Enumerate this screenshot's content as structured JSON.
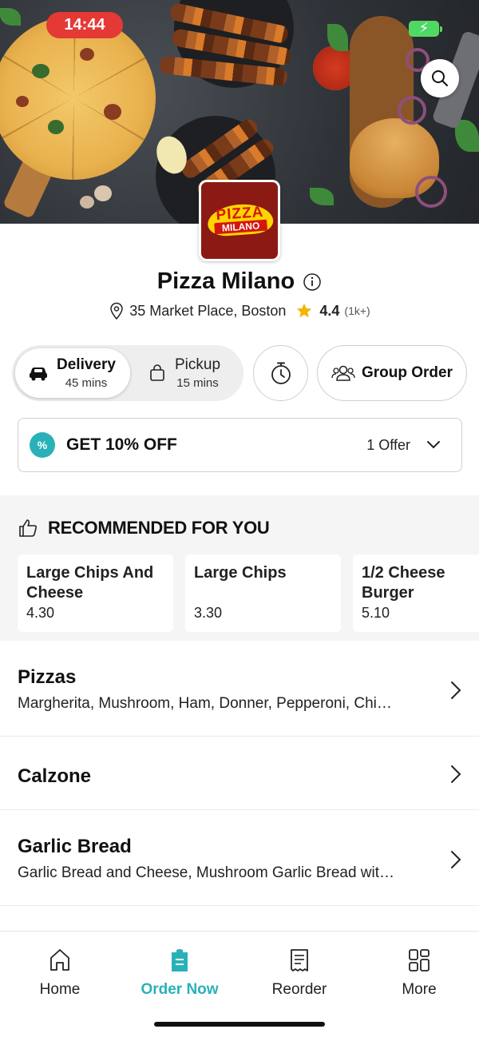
{
  "status": {
    "time": "14:44"
  },
  "restaurant": {
    "name": "Pizza Milano",
    "address": "35 Market Place, Boston",
    "rating": "4.4",
    "rating_count": "(1k+)",
    "logo": {
      "top": "PIZZA",
      "bottom": "MILANO"
    }
  },
  "modes": {
    "delivery": {
      "label": "Delivery",
      "time": "45 mins"
    },
    "pickup": {
      "label": "Pickup",
      "time": "15 mins"
    },
    "group_order_label": "Group Order"
  },
  "offer": {
    "title": "GET 10% OFF",
    "count": "1 Offer",
    "badge": "%"
  },
  "recommended": {
    "title": "RECOMMENDED FOR YOU",
    "items": [
      {
        "name": "Large Chips And Cheese",
        "price": "4.30"
      },
      {
        "name": "Large Chips",
        "price": "3.30"
      },
      {
        "name": "1/2 Cheese Burger",
        "price": "5.10"
      }
    ]
  },
  "categories": [
    {
      "name": "Pizzas",
      "desc": "Margherita, Mushroom, Ham, Donner, Pepperoni, Chi…"
    },
    {
      "name": "Calzone",
      "desc": ""
    },
    {
      "name": "Garlic Bread",
      "desc": "Garlic Bread and Cheese, Mushroom Garlic Bread wit…"
    }
  ],
  "nav": {
    "items": [
      {
        "label": "Home",
        "icon": "home-icon"
      },
      {
        "label": "Order Now",
        "icon": "order-icon"
      },
      {
        "label": "Reorder",
        "icon": "receipt-icon"
      },
      {
        "label": "More",
        "icon": "grid-icon"
      }
    ],
    "active_color": "#2ab1b8"
  },
  "colors": {
    "accent": "#2ab1b8",
    "status_time_bg": "#e53935",
    "rating_star": "#f5b400"
  }
}
